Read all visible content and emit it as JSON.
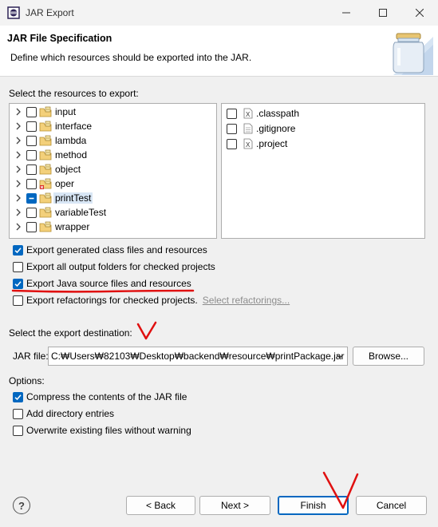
{
  "window": {
    "title": "JAR Export"
  },
  "header": {
    "title": "JAR File Specification",
    "description": "Define which resources should be exported into the JAR."
  },
  "resources": {
    "label": "Select the resources to export:",
    "tree": [
      {
        "label": "input",
        "checked": false
      },
      {
        "label": "interface",
        "checked": false
      },
      {
        "label": "lambda",
        "checked": false
      },
      {
        "label": "method",
        "checked": false
      },
      {
        "label": "object",
        "checked": false
      },
      {
        "label": "oper",
        "checked": false
      },
      {
        "label": "printTest",
        "checked": "partial",
        "selected": true
      },
      {
        "label": "variableTest",
        "checked": false
      },
      {
        "label": "wrapper",
        "checked": false
      }
    ],
    "files": [
      {
        "label": ".classpath",
        "checked": false
      },
      {
        "label": ".gitignore",
        "checked": false
      },
      {
        "label": ".project",
        "checked": false
      }
    ]
  },
  "options_export": [
    {
      "label": "Export generated class files and resources",
      "checked": true
    },
    {
      "label": "Export all output folders for checked projects",
      "checked": false
    },
    {
      "label": "Export Java source files and resources",
      "checked": true
    },
    {
      "label": "Export refactorings for checked projects.",
      "checked": false,
      "link": "Select refactorings..."
    }
  ],
  "destination": {
    "label": "Select the export destination:",
    "jar_label": "JAR file:",
    "jar_value": "C:₩Users₩82103₩Desktop₩backend₩resource₩printPackage.jar",
    "browse_label": "Browse..."
  },
  "options": {
    "label": "Options:",
    "items": [
      {
        "label": "Compress the contents of the JAR file",
        "checked": true
      },
      {
        "label": "Add directory entries",
        "checked": false
      },
      {
        "label": "Overwrite existing files without warning",
        "checked": false
      }
    ]
  },
  "footer": {
    "help_label": "?",
    "back_label": "< Back",
    "next_label": "Next >",
    "finish_label": "Finish",
    "cancel_label": "Cancel"
  },
  "colors": {
    "accent": "#0067c0",
    "annotation": "#e01010"
  }
}
